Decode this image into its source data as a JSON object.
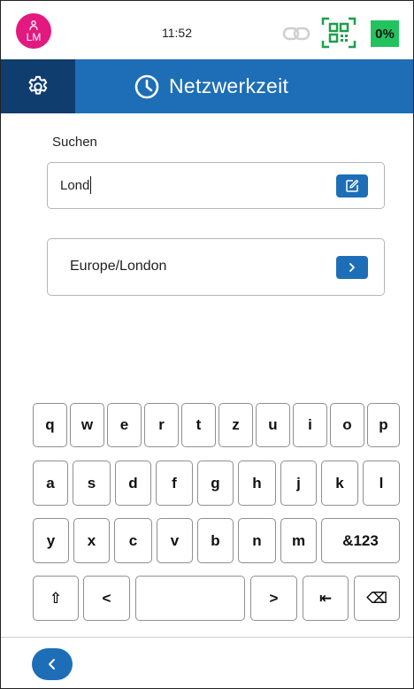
{
  "status_bar": {
    "avatar_initials": "LM",
    "time": "11:52",
    "battery": "0%",
    "icons": [
      "user-icon",
      "link-icon",
      "qr-code-icon"
    ]
  },
  "header": {
    "title": "Netzwerkzeit",
    "icons": [
      "gear-icon",
      "clock-icon"
    ]
  },
  "search": {
    "label": "Suchen",
    "value": "Lond",
    "edit_icon": "edit-icon"
  },
  "results": [
    {
      "label": "Europe/London",
      "icon": "chevron-right-icon"
    }
  ],
  "keyboard": {
    "rows": [
      [
        "q",
        "w",
        "e",
        "r",
        "t",
        "z",
        "u",
        "i",
        "o",
        "p"
      ],
      [
        "a",
        "s",
        "d",
        "f",
        "g",
        "h",
        "j",
        "k",
        "l"
      ],
      [
        "y",
        "x",
        "c",
        "v",
        "b",
        "n",
        "m",
        "&123"
      ],
      [
        "⇧",
        "<",
        "",
        ">",
        "⇤",
        "⌫"
      ]
    ]
  },
  "footer": {
    "back_icon": "chevron-left-icon"
  },
  "colors": {
    "primary": "#1d6eb7",
    "primary_dark": "#0f3d6e",
    "avatar": "#e3197f",
    "battery": "#22c35e",
    "qr": "#1e9e4a"
  }
}
